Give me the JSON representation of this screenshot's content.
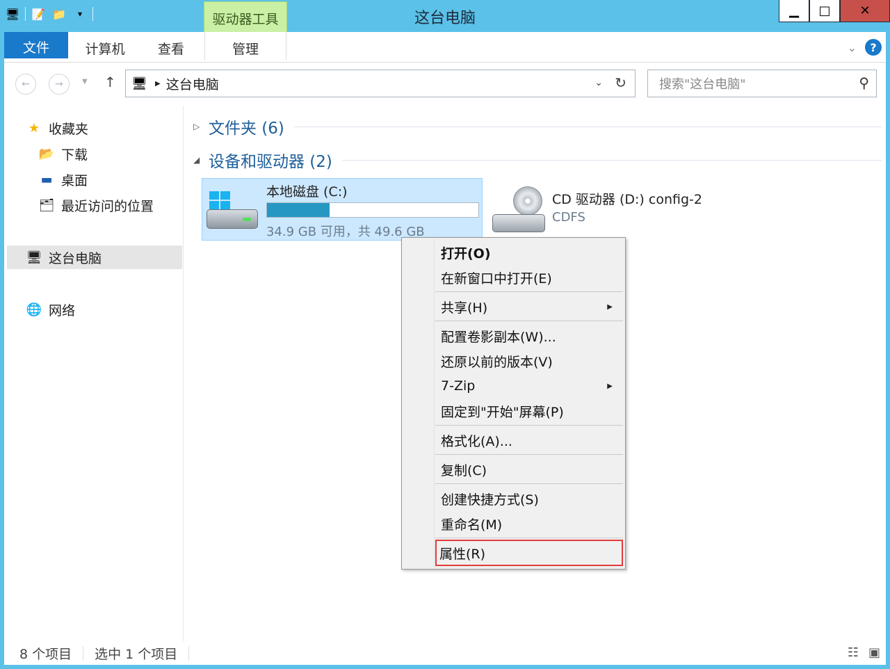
{
  "window": {
    "title": "这台电脑",
    "context_tab": "驱动器工具"
  },
  "ribbon": {
    "tabs": [
      "文件",
      "计算机",
      "查看",
      "管理"
    ]
  },
  "address": {
    "path": "这台电脑"
  },
  "search": {
    "placeholder": "搜索\"这台电脑\""
  },
  "nav": {
    "favorites": "收藏夹",
    "downloads": "下载",
    "desktop": "桌面",
    "recent": "最近访问的位置",
    "thispc": "这台电脑",
    "network": "网络"
  },
  "groups": {
    "folders": "文件夹 (6)",
    "devices": "设备和驱动器 (2)"
  },
  "drives": {
    "c": {
      "name": "本地磁盘 (C:)",
      "free_text": "34.9 GB 可用，共 49.6 GB",
      "used_fraction": 0.296
    },
    "d": {
      "name": "CD 驱动器 (D:) config-2",
      "fs": "CDFS"
    }
  },
  "context_menu": {
    "items": [
      "打开(O)",
      "在新窗口中打开(E)",
      "共享(H)",
      "配置卷影副本(W)...",
      "还原以前的版本(V)",
      "7-Zip",
      "固定到\"开始\"屏幕(P)",
      "格式化(A)...",
      "复制(C)",
      "创建快捷方式(S)",
      "重命名(M)",
      "属性(R)"
    ]
  },
  "status": {
    "count": "8 个项目",
    "selected": "选中 1 个项目"
  },
  "colors": {
    "accent": "#1979ca",
    "title_bar": "#5bc1e8",
    "highlight_box": "#e33a3a",
    "selection": "#cce8ff"
  }
}
